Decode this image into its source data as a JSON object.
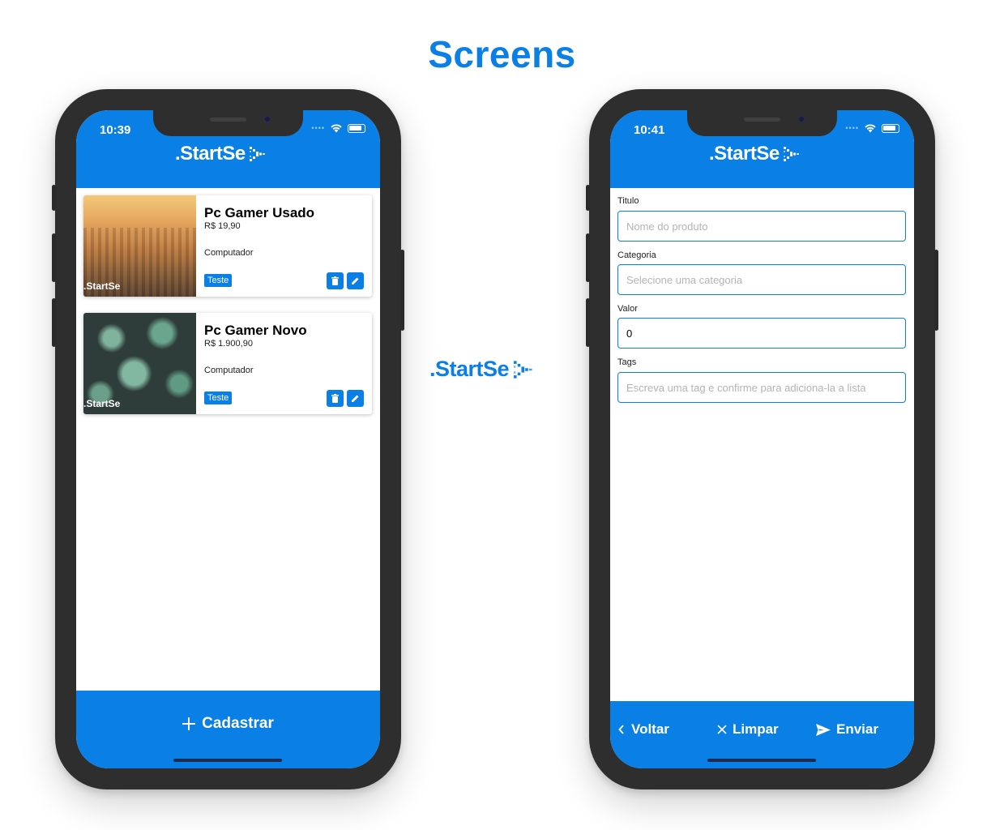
{
  "page": {
    "title": "Screens"
  },
  "brand": {
    "name": ".StartSe",
    "color": "#0a7fe6"
  },
  "list_screen": {
    "time": "10:39",
    "products": [
      {
        "title": "Pc Gamer Usado",
        "price": "R$ 19,90",
        "category": "Computador",
        "tag": "Teste",
        "image": "city-sunset",
        "watermark": ".StartSe"
      },
      {
        "title": "Pc Gamer Novo",
        "price": "R$ 1.900,90",
        "category": "Computador",
        "tag": "Teste",
        "image": "succulents",
        "watermark": ".StartSe"
      }
    ],
    "register_button": "Cadastrar"
  },
  "form_screen": {
    "time": "10:41",
    "fields": [
      {
        "label": "Titulo",
        "placeholder": "Nome do produto",
        "value": ""
      },
      {
        "label": "Categoria",
        "placeholder": "Selecione uma categoria",
        "value": ""
      },
      {
        "label": "Valor",
        "placeholder": "",
        "value": "0"
      },
      {
        "label": "Tags",
        "placeholder": "Escreva uma tag e confirme para adiciona-la a lista",
        "value": ""
      }
    ],
    "buttons": {
      "back": "Voltar",
      "clear": "Limpar",
      "send": "Enviar"
    }
  }
}
